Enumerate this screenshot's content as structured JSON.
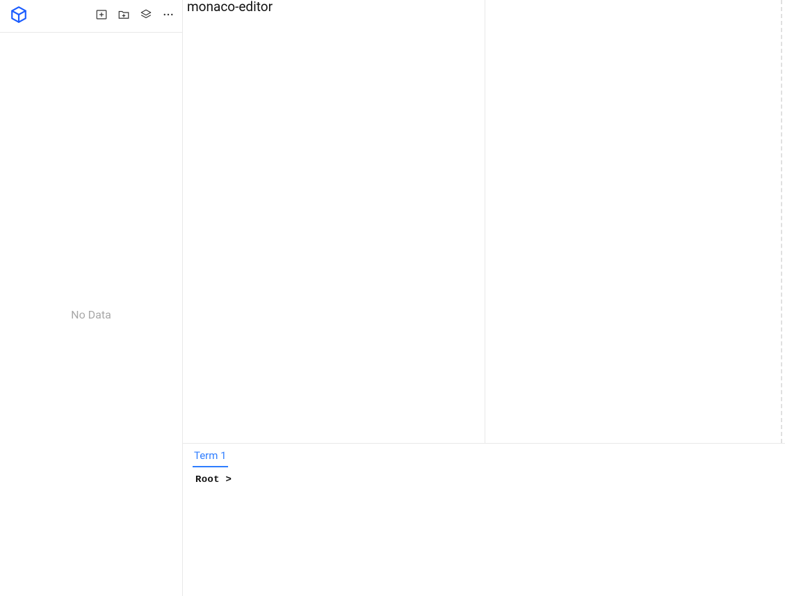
{
  "sidebar": {
    "empty_text": "No Data"
  },
  "editor": {
    "title": "monaco-editor"
  },
  "terminal": {
    "tabs": [
      {
        "label": "Term 1"
      }
    ],
    "prompt_user": "Root",
    "prompt_symbol": ">"
  }
}
